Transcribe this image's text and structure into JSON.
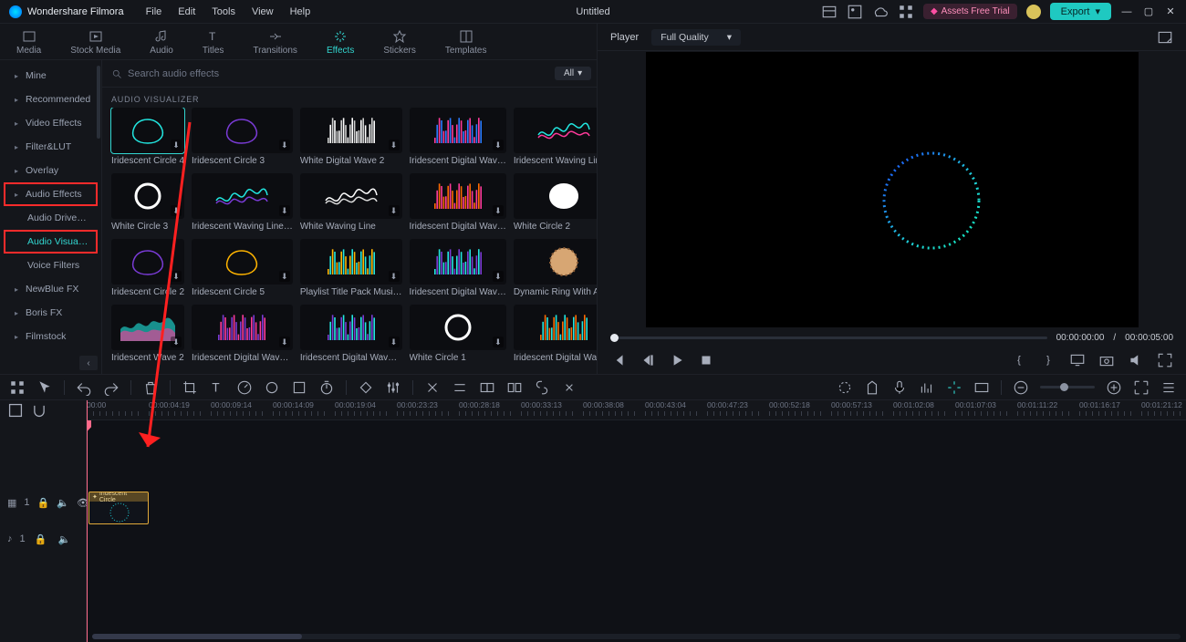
{
  "brand": "Wondershare Filmora",
  "menu": {
    "file": "File",
    "edit": "Edit",
    "tools": "Tools",
    "view": "View",
    "help": "Help"
  },
  "doc_title": "Untitled",
  "assets_btn": "Assets Free Trial",
  "export_btn": "Export",
  "module_tabs": {
    "media": "Media",
    "stock": "Stock Media",
    "audio": "Audio",
    "titles": "Titles",
    "transitions": "Transitions",
    "effects": "Effects",
    "stickers": "Stickers",
    "templates": "Templates"
  },
  "sidebar": {
    "items": [
      {
        "label": "Mine"
      },
      {
        "label": "Recommended"
      },
      {
        "label": "Video Effects"
      },
      {
        "label": "Filter&LUT"
      },
      {
        "label": "Overlay"
      },
      {
        "label": "Audio Effects",
        "hl": true
      },
      {
        "label": "Audio Drive…",
        "sub": true
      },
      {
        "label": "Audio Visua…",
        "sub": true,
        "hl": true,
        "active": true
      },
      {
        "label": "Voice Filters",
        "sub": true
      },
      {
        "label": "NewBlue FX"
      },
      {
        "label": "Boris FX"
      },
      {
        "label": "Filmstock"
      }
    ]
  },
  "search_placeholder": "Search audio effects",
  "all_label": "All",
  "section_title": "AUDIO VISUALIZER",
  "effects": [
    {
      "name": "Iridescent Circle 4",
      "kind": "circle",
      "c1": "#22e7e1",
      "c2": "#56f",
      "sel": true
    },
    {
      "name": "Iridescent Circle 3",
      "kind": "circle",
      "c1": "#7a3bd6",
      "c2": "#ff6a00"
    },
    {
      "name": "White  Digital Wave 2",
      "kind": "bars",
      "c1": "#fff",
      "c2": "#ccc"
    },
    {
      "name": "Iridescent Digital Wav…",
      "kind": "bars",
      "c1": "#2a7bff",
      "c2": "#ff3a9a"
    },
    {
      "name": "Iridescent Waving Line…",
      "kind": "lines",
      "c1": "#22e7e1",
      "c2": "#ff3a9a"
    },
    {
      "name": "White Circle 3",
      "kind": "ring",
      "c1": "#fff",
      "c2": "#ddd"
    },
    {
      "name": "Iridescent Waving Line…",
      "kind": "lines",
      "c1": "#22e7e1",
      "c2": "#7a3bd6"
    },
    {
      "name": "White Waving Line",
      "kind": "lines",
      "c1": "#fff",
      "c2": "#ddd"
    },
    {
      "name": "Iridescent Digital Wav…",
      "kind": "bars",
      "c1": "#ff3a9a",
      "c2": "#ff6a00"
    },
    {
      "name": "White Circle 2",
      "kind": "blob",
      "c1": "#fff",
      "c2": "#eee"
    },
    {
      "name": "Iridescent Circle 2",
      "kind": "circle",
      "c1": "#7a3bd6",
      "c2": "#ff3a9a"
    },
    {
      "name": "Iridescent Circle 5",
      "kind": "circle",
      "c1": "#ffb400",
      "c2": "#7a3bd6"
    },
    {
      "name": "Playlist Title Pack Musi…",
      "kind": "bars",
      "c1": "#22e7e1",
      "c2": "#ffb400"
    },
    {
      "name": "Iridescent Digital Wav…",
      "kind": "bars",
      "c1": "#7a3bd6",
      "c2": "#22e7e1"
    },
    {
      "name": "Dynamic Ring With Ai …",
      "kind": "photo",
      "c1": "#d7a673",
      "c2": "#8a5b34"
    },
    {
      "name": "Iridescent Wave 2",
      "kind": "area",
      "c1": "#22e7e1",
      "c2": "#ff3a9a"
    },
    {
      "name": "Iridescent Digital Wav…",
      "kind": "bars",
      "c1": "#ff3a9a",
      "c2": "#7a3bd6"
    },
    {
      "name": "Iridescent Digital Wav…",
      "kind": "bars",
      "c1": "#22e7e1",
      "c2": "#7a3bd6"
    },
    {
      "name": "White Circle 1",
      "kind": "ring",
      "c1": "#fff",
      "c2": "#ddd"
    },
    {
      "name": "Iridescent Digital Wav…",
      "kind": "bars",
      "c1": "#22e7e1",
      "c2": "#ff6a00"
    }
  ],
  "player": {
    "label": "Player",
    "quality": "Full Quality",
    "time_cur": "00:00:00:00",
    "time_sep": "/",
    "time_tot": "00:00:05:00"
  },
  "timeline": {
    "ticks": [
      "00:00",
      "00:00:04:19",
      "00:00:09:14",
      "00:00:14:09",
      "00:00:19:04",
      "00:00:23:23",
      "00:00:28:18",
      "00:00:33:13",
      "00:00:38:08",
      "00:00:43:04",
      "00:00:47:23",
      "00:00:52:18",
      "00:00:57:13",
      "00:01:02:08",
      "00:01:07:03",
      "00:01:11:22",
      "00:01:16:17",
      "00:01:21:12"
    ],
    "video_track": "1",
    "audio_track": "1",
    "clip_label": "Iridescent Circle"
  }
}
